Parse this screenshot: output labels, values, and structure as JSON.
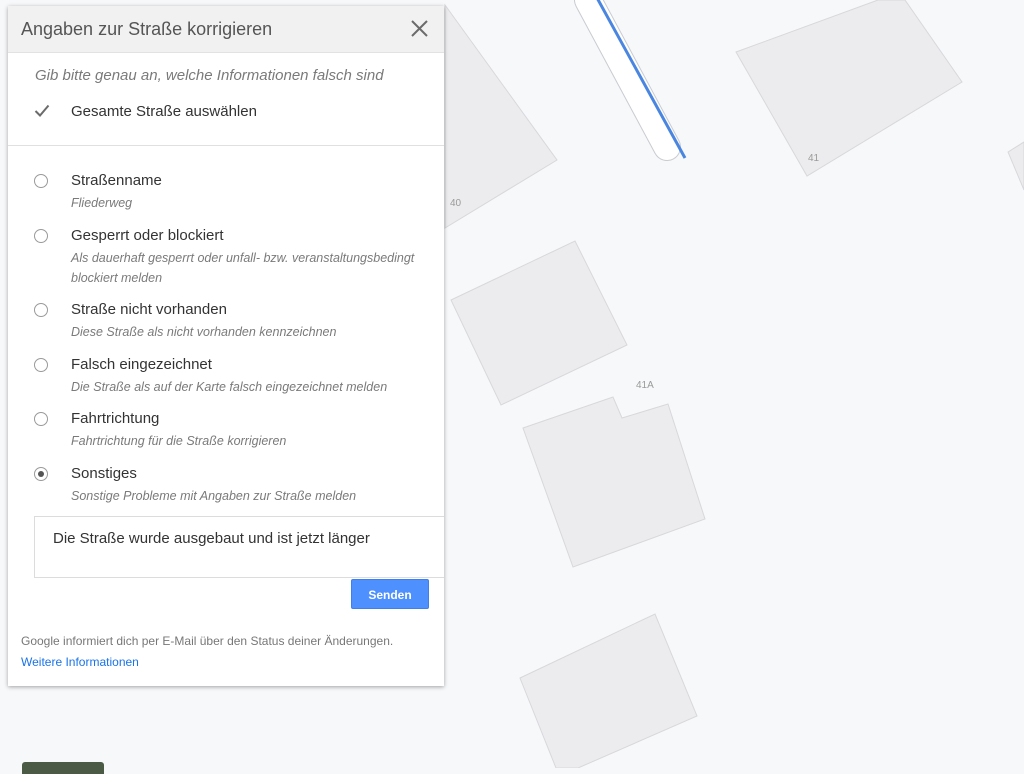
{
  "map": {
    "house_numbers": [
      "40",
      "41",
      "41A"
    ]
  },
  "panel": {
    "title": "Angaben zur Straße korrigieren",
    "close_icon": "close-icon",
    "hint": "Gib bitte genau an, welche Informationen falsch sind",
    "select_all_label": "Gesamte Straße auswählen",
    "select_all_checked": true,
    "options": [
      {
        "label": "Straßenname",
        "desc": "Fliederweg",
        "selected": false
      },
      {
        "label": "Gesperrt oder blockiert",
        "desc": "Als dauerhaft gesperrt oder unfall- bzw. veranstaltungsbedingt blockiert melden",
        "selected": false
      },
      {
        "label": "Straße nicht vorhanden",
        "desc": "Diese Straße als nicht vorhanden kennzeichnen",
        "selected": false
      },
      {
        "label": "Falsch eingezeichnet",
        "desc": "Die Straße als auf der Karte falsch eingezeichnet melden",
        "selected": false
      },
      {
        "label": "Fahrtrichtung",
        "desc": "Fahrtrichtung für die Straße korrigieren",
        "selected": false
      },
      {
        "label": "Sonstiges",
        "desc": "Sonstige Probleme mit Angaben zur Straße melden",
        "selected": true
      }
    ],
    "comment_value": "Die Straße wurde ausgebaut und ist jetzt länger",
    "send_label": "Senden",
    "footer_text": "Google informiert dich per E-Mail über den Status deiner Änderungen.",
    "footer_link": "Weitere Informationen"
  },
  "colors": {
    "accent": "#4d90fe",
    "road_line": "#4a86e0",
    "building_fill": "#ececee",
    "map_bg": "#f7f8fa"
  }
}
